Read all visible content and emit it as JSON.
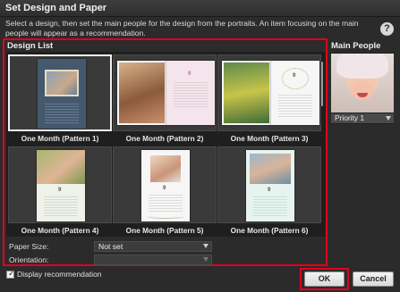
{
  "window": {
    "title": "Set Design and Paper"
  },
  "description": "Select a design, then set the main people for the design from the portraits. An item focusing on the main people will appear as a recommendation.",
  "help_icon": "help-icon",
  "design_list": {
    "title": "Design List",
    "items": [
      {
        "label": "One Month (Pattern 1)",
        "selected": true
      },
      {
        "label": "One Month (Pattern 2)",
        "selected": false
      },
      {
        "label": "One Month (Pattern 3)",
        "selected": false
      },
      {
        "label": "One Month (Pattern 4)",
        "selected": false
      },
      {
        "label": "One Month (Pattern 5)",
        "selected": false
      },
      {
        "label": "One Month (Pattern 6)",
        "selected": false
      }
    ]
  },
  "paper": {
    "paper_size_label": "Paper Size:",
    "paper_size_value": "Not set",
    "orientation_label": "Orientation:",
    "orientation_value": ""
  },
  "main_people": {
    "title": "Main People",
    "priority_value": "Priority 1"
  },
  "footer": {
    "display_recommendation_label": "Display recommendation",
    "display_recommendation_checked": true,
    "ok_label": "OK",
    "cancel_label": "Cancel"
  },
  "colors": {
    "highlight": "#e3001b",
    "background": "#2b2b2b"
  }
}
